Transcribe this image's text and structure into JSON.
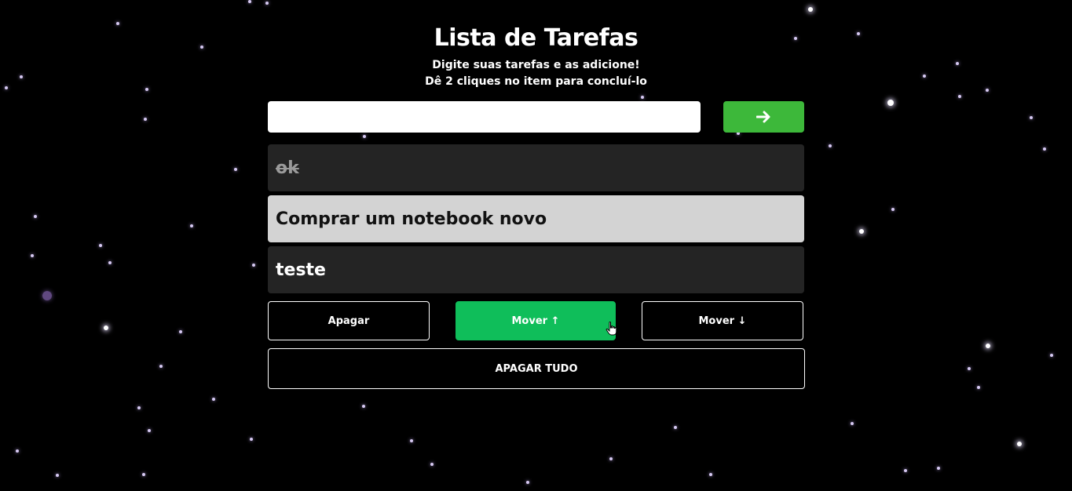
{
  "header": {
    "title": "Lista de Tarefas",
    "subtitle_line1": "Digite suas tarefas e as adicione!",
    "subtitle_line2": "Dê 2 cliques no item para concluí-lo"
  },
  "input": {
    "value": "",
    "placeholder": ""
  },
  "add_button": {
    "icon": "arrow-right-icon",
    "glyph": "➔",
    "color": "#3db83a"
  },
  "tasks": [
    {
      "label": "ok",
      "done": true,
      "selected": false
    },
    {
      "label": "Comprar um notebook novo",
      "done": false,
      "selected": true
    },
    {
      "label": "teste",
      "done": false,
      "selected": false
    }
  ],
  "actions": {
    "delete_label": "Apagar",
    "move_up_label": "Mover ↑",
    "move_down_label": "Mover ↓",
    "clear_all_label": "APAGAR TUDO",
    "active_color": "#0fbe5a"
  },
  "theme": {
    "background": "#000000",
    "task_bg": "#242424",
    "task_selected_bg": "#d3d3d3"
  }
}
